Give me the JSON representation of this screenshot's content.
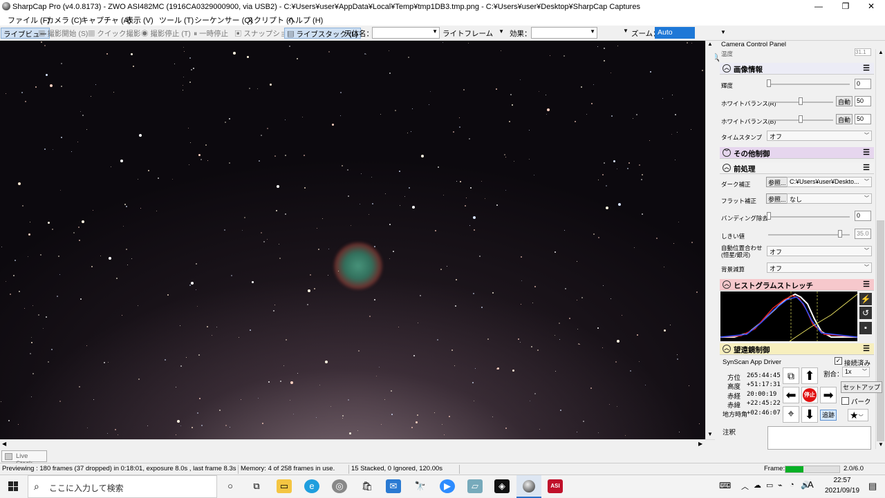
{
  "window": {
    "title": "SharpCap Pro (v4.0.8173) - ZWO ASI482MC (1916CA0329000900, via USB2) - C:¥Users¥user¥AppData¥Local¥Temp¥tmp1DB3.tmp.png - C:¥Users¥user¥Desktop¥SharpCap Captures",
    "minimize": "—",
    "maximize": "❐",
    "close": "✕"
  },
  "menu": [
    "ファイル (F)",
    "カメラ (C)",
    "キャプチャ (A)",
    "表示 (V)",
    "ツール (T)",
    "シーケンサー (Q)",
    "スクリプト (I)",
    "ヘルプ (H)"
  ],
  "toolbar": {
    "live_view": "ライブビュー",
    "start_capture": "撮影開始 (S)",
    "quick_capture": "クイック撮影",
    "stop_capture": "撮影停止 (T)",
    "pause": "一時停止",
    "snapshot": "スナップショット",
    "live_stack": "ライブスタック (L)",
    "target_label": "天体名：",
    "target_value": "",
    "frame_type": "ライトフレーム",
    "effect_label": "効果：",
    "effect_value": "",
    "zoom_label": "ズーム：",
    "zoom_value": "Auto"
  },
  "panel": {
    "header": "Camera Control Panel",
    "temp_value": "31.1",
    "image_info": {
      "title": "画像情報",
      "brightness_label": "輝度",
      "brightness_value": "0",
      "wb_r_label": "ホワイトバランス(R)",
      "wb_r_value": "50",
      "wb_b_label": "ホワイトバランス(B)",
      "wb_b_value": "50",
      "auto_label": "自動",
      "timestamp_label": "タイムスタンプ",
      "timestamp_value": "オフ"
    },
    "other_controls": {
      "title": "その他制御"
    },
    "preprocessing": {
      "title": "前処理",
      "dark_label": "ダーク補正",
      "dark_button": "参照...",
      "dark_value": "C:¥Users¥user¥Deskto...",
      "flat_label": "フラット補正",
      "flat_button": "参照...",
      "flat_value": "なし",
      "banding_label": "バンディング除去",
      "banding_value": "0",
      "threshold_label": "しきい値",
      "threshold_value": "35.0",
      "auto_align_label": "自動位置合わせ (恒星/銀河)",
      "auto_align_value": "オフ",
      "bg_label": "背景減算",
      "bg_value": "オフ"
    },
    "histogram": {
      "title": "ヒストグラムストレッチ"
    },
    "telescope": {
      "title": "望遠鏡制御",
      "driver": "SynScan App Driver",
      "connected_label": "接続済み",
      "rate_label": "割合：",
      "rate_value": "1x",
      "az_label": "方位",
      "az_value": "265:44:45",
      "alt_label": "高度",
      "alt_value": "+51:17:31",
      "ra_label": "赤経",
      "ra_value": "20:00:19",
      "dec_label": "赤緯",
      "dec_value": "+22:45:22",
      "ha_label": "地方時角",
      "ha_value": "+02:46:07",
      "stop_label": "停止",
      "setup_label": "セットアップ",
      "park_label": "パーク",
      "track_label": "追跡"
    },
    "notes_label": "注釈"
  },
  "livestack_tab": "Live Stack",
  "status": {
    "preview": "Previewing : 180 frames (37 dropped) in 0:18:01, exposure 8.0s , last frame 8.3s",
    "memory": "Memory: 4 of 258 frames in use.",
    "stacked": "15 Stacked, 0 Ignored, 120.00s",
    "frame_label": "Frame:",
    "frame_value": "2.0/6.0",
    "frame_fraction": 0.333
  },
  "taskbar": {
    "search_placeholder": "ここに入力して検索",
    "time": "22:57",
    "date": "2021/09/19",
    "ime": "A"
  }
}
